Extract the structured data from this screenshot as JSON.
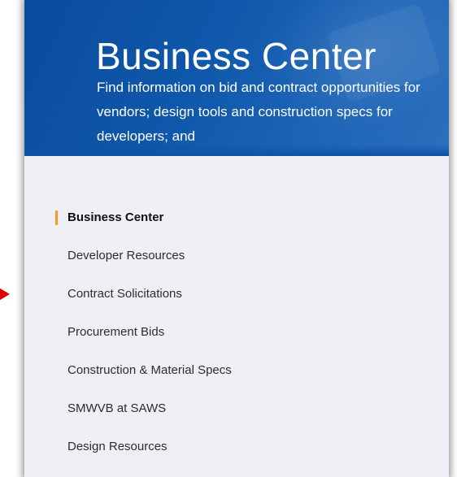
{
  "hero": {
    "title": "Business Center",
    "description": "Find information on bid and contract opportunities for vendors; design tools and construction specs for developers; and"
  },
  "nav": {
    "items": [
      {
        "label": "Business Center",
        "active": true
      },
      {
        "label": "Developer Resources",
        "active": false
      },
      {
        "label": "Contract Solicitations",
        "active": false
      },
      {
        "label": "Procurement Bids",
        "active": false
      },
      {
        "label": "Construction & Material Specs",
        "active": false
      },
      {
        "label": "SMWVB at SAWS",
        "active": false
      },
      {
        "label": "Design Resources",
        "active": false
      }
    ]
  },
  "colors": {
    "hero_blue": "#0f57aa",
    "active_accent": "#f39a2b",
    "panel_background": "#eef0f5",
    "pointer_arrow": "#e00000"
  },
  "icons": {
    "pointer": "red-arrow-pointer-icon"
  }
}
